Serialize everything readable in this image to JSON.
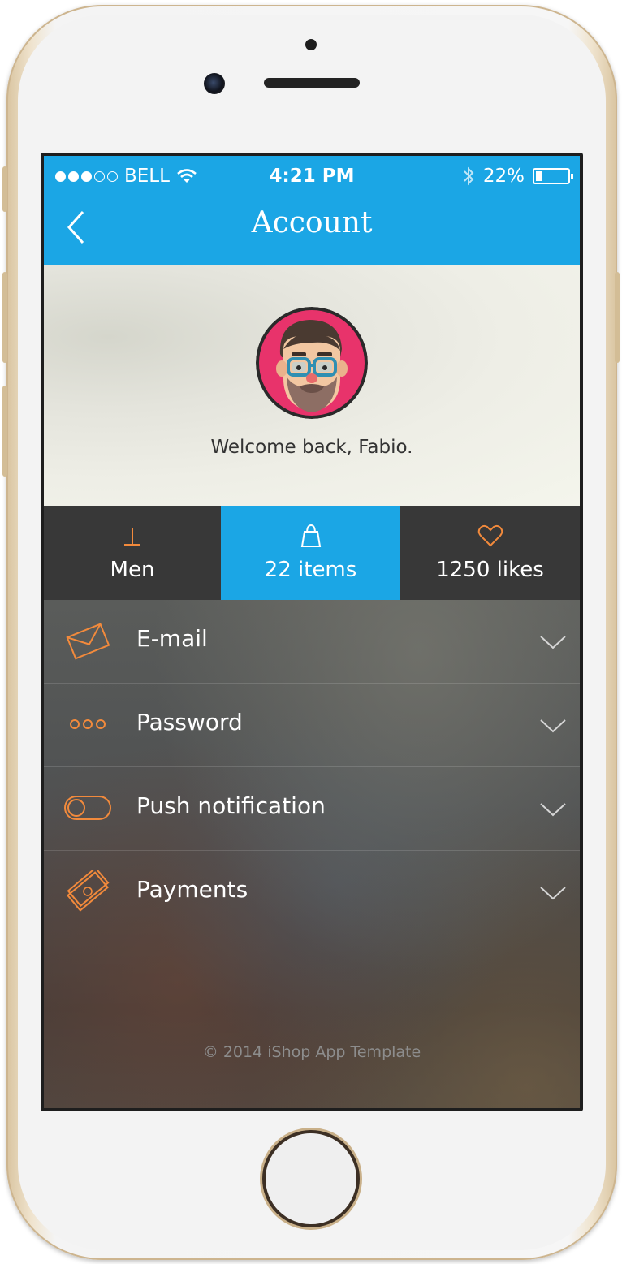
{
  "status_bar": {
    "carrier": "BELL",
    "time": "4:21 PM",
    "battery": "22%",
    "battery_level": 0.22,
    "signal_bars_filled": 3,
    "signal_bars_total": 5,
    "icons": [
      "wifi-icon",
      "bluetooth-icon",
      "battery-icon"
    ]
  },
  "nav": {
    "title": "Account",
    "back_icon": "chevron-left-icon"
  },
  "profile": {
    "welcome": "Welcome back, Fabio."
  },
  "tabs": [
    {
      "label": "Men",
      "icon": "men-icon",
      "active": false
    },
    {
      "label": "22 items",
      "icon": "shopping-bag-icon",
      "active": true
    },
    {
      "label": "1250 likes",
      "icon": "heart-icon",
      "active": false
    }
  ],
  "settings": [
    {
      "label": "E-mail",
      "icon": "envelope-icon"
    },
    {
      "label": "Password",
      "icon": "password-dots-icon"
    },
    {
      "label": "Push notification",
      "icon": "toggle-icon"
    },
    {
      "label": "Payments",
      "icon": "payment-card-icon"
    }
  ],
  "footer": "© 2014 iShop App Template",
  "colors": {
    "primary": "#1ba6e5",
    "accent": "#f28a3c",
    "tab_bg": "#383838"
  }
}
